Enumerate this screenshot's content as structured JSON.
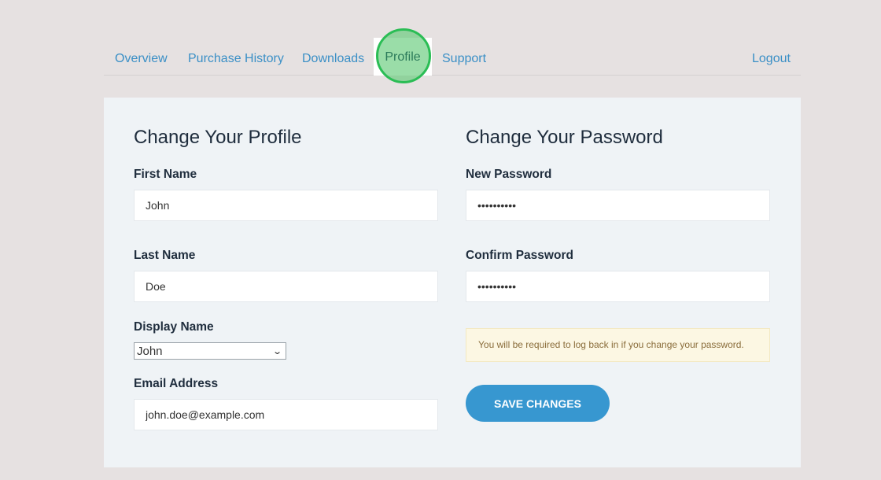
{
  "nav": {
    "items": [
      {
        "label": "Overview"
      },
      {
        "label": "Purchase History"
      },
      {
        "label": "Downloads"
      },
      {
        "label": "Profile"
      },
      {
        "label": "Support"
      }
    ],
    "logout": "Logout",
    "active": "Profile"
  },
  "profile": {
    "title": "Change Your Profile",
    "first_name_label": "First Name",
    "first_name_value": "John",
    "last_name_label": "Last Name",
    "last_name_value": "Doe",
    "display_name_label": "Display Name",
    "display_name_value": "John",
    "email_label": "Email Address",
    "email_value": "john.doe@example.com"
  },
  "password": {
    "title": "Change Your Password",
    "new_label": "New Password",
    "new_value": "••••••••••",
    "confirm_label": "Confirm Password",
    "confirm_value": "••••••••••",
    "notice": "You will be required to log back in if you change your password.",
    "save_label": "SAVE CHANGES"
  },
  "colors": {
    "accent": "#3797d0",
    "link": "#3a8fc6",
    "highlight": "#5cc873",
    "notice_bg": "#fcf7e3"
  }
}
